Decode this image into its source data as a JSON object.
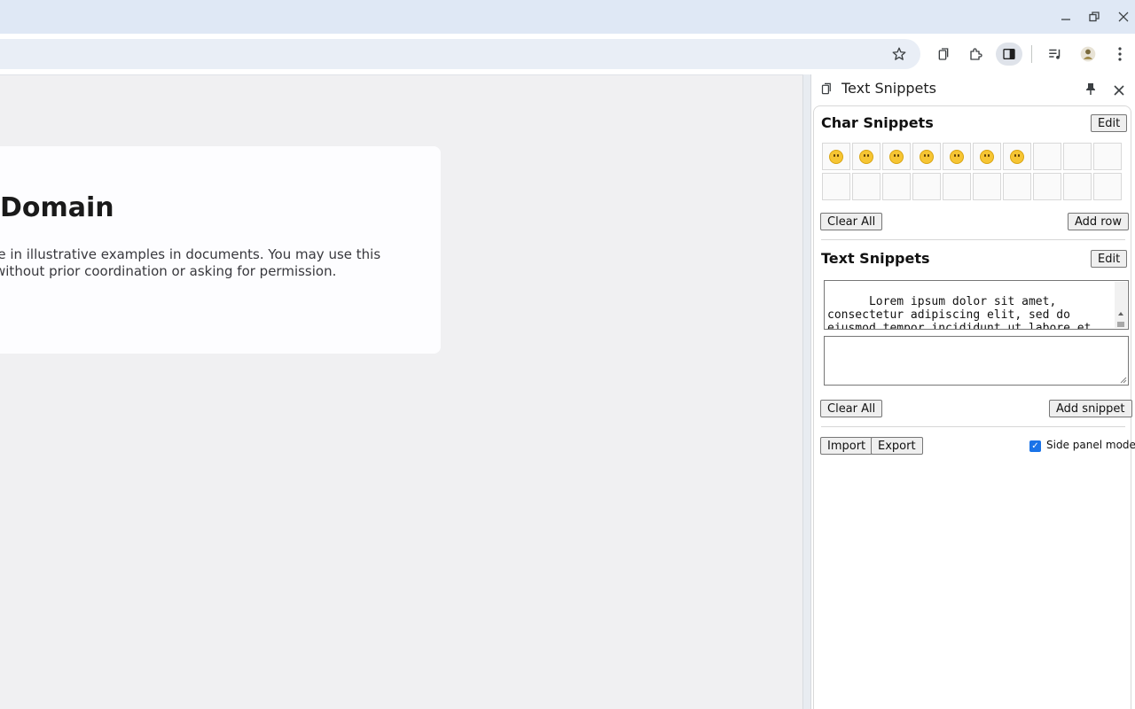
{
  "browser": {
    "window_controls": [
      "minimize-icon",
      "restore-icon",
      "close-icon"
    ],
    "toolbar_icons": [
      "bookmark-star-icon",
      "clipboard-extension-icon",
      "extensions-puzzle-icon",
      "side-panel-icon",
      "media-control-icon",
      "profile-avatar-icon",
      "menu-kebab-icon"
    ]
  },
  "page": {
    "heading": "Domain",
    "paragraph_line1": "use in illustrative examples in documents. You may use this",
    "paragraph_line2": "e without prior coordination or asking for permission.",
    "paragraph_line3": "."
  },
  "side_panel": {
    "title": "Text Snippets",
    "char_section": {
      "title": "Char Snippets",
      "edit_label": "Edit",
      "clear_label": "Clear All",
      "add_label": "Add row",
      "cells": [
        "😀",
        "😁",
        "😂",
        "😃",
        "😄",
        "😅",
        "😆",
        "",
        "",
        "",
        "",
        "",
        "",
        "",
        "",
        "",
        "",
        "",
        "",
        ""
      ]
    },
    "text_section": {
      "title": "Text Snippets",
      "edit_label": "Edit",
      "snippet_text": "Lorem ipsum dolor sit amet, consectetur adipiscing elit, sed do eiusmod tempor incididunt ut labore et dolore magna aliqua. Ut enim ad minim veniam, quis",
      "new_snippet_value": "",
      "clear_label": "Clear All",
      "add_label": "Add snippet"
    },
    "footer": {
      "import_label": "Import",
      "export_label": "Export",
      "side_panel_mode_label": "Side panel mode",
      "side_panel_mode_checked": true
    }
  },
  "colors": {
    "accent": "#1a73e8",
    "frame": "#dfe8f5",
    "emoji": "#f6c533"
  }
}
